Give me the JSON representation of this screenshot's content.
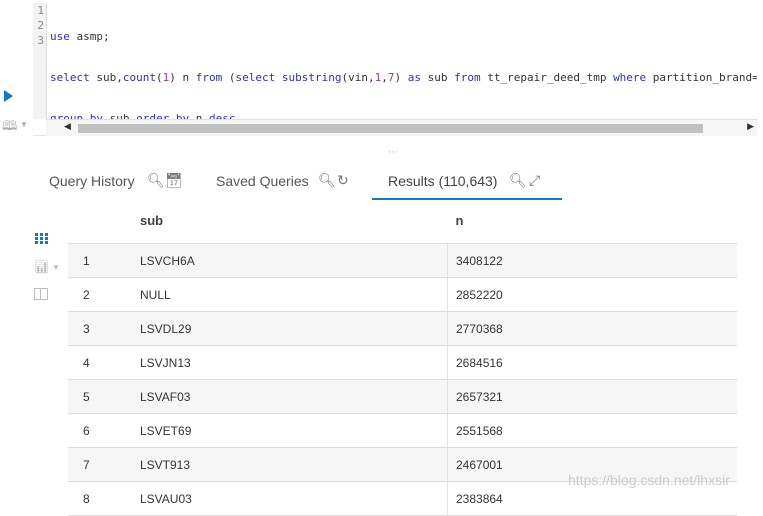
{
  "editor": {
    "line_numbers": [
      "1",
      "2",
      "3"
    ],
    "lines": [
      "use asmp;",
      "select sub,count(1) n from (select substring(vin,1,7) as sub from tt_repair_deed_tmp where partition_brand=",
      "group by sub order by n desc"
    ]
  },
  "left_toolbar": {
    "run_icon": "play-icon",
    "snippet_icon": "book-icon"
  },
  "tabs": [
    {
      "label": "Query History",
      "icons": [
        "search-icon",
        "calendar-x-icon"
      ]
    },
    {
      "label": "Saved Queries",
      "icons": [
        "search-icon",
        "refresh-icon"
      ]
    },
    {
      "label": "Results (110,643)",
      "icons": [
        "search-icon",
        "expand-icon"
      ],
      "active": true
    }
  ],
  "results": {
    "columns": [
      "sub",
      "n"
    ],
    "rows": [
      {
        "idx": "1",
        "sub": "LSVCH6A",
        "n": "3408122"
      },
      {
        "idx": "2",
        "sub": "NULL",
        "n": "2852220"
      },
      {
        "idx": "3",
        "sub": "LSVDL29",
        "n": "2770368"
      },
      {
        "idx": "4",
        "sub": "LSVJN13",
        "n": "2684516"
      },
      {
        "idx": "5",
        "sub": "LSVAF03",
        "n": "2657321"
      },
      {
        "idx": "6",
        "sub": "LSVET69",
        "n": "2551568"
      },
      {
        "idx": "7",
        "sub": "LSVT913",
        "n": "2467001"
      },
      {
        "idx": "8",
        "sub": "LSVAU03",
        "n": "2383864"
      }
    ]
  },
  "watermark": "https://blog.csdn.net/lhxsir",
  "colors": {
    "accent": "#1178c6",
    "keyword": "#2a33aa",
    "number": "#9b3b9b"
  }
}
